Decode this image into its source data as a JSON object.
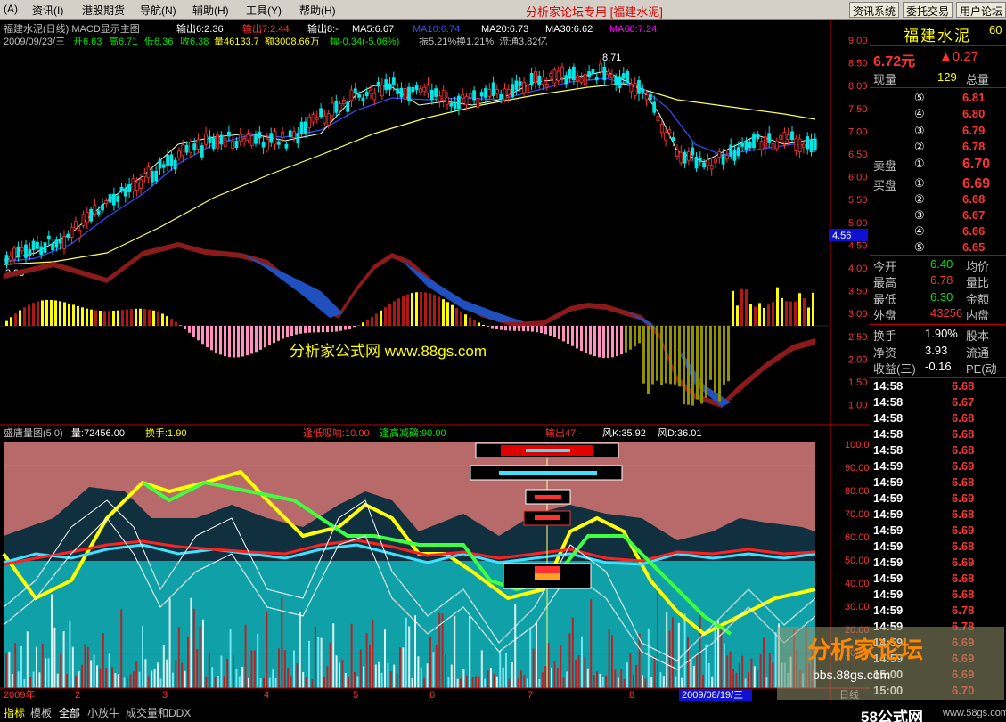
{
  "menu": {
    "items": [
      "(A)",
      "资讯(I)",
      "港股期货",
      "导航(N)",
      "辅助(H)",
      "工具(Y)",
      "帮助(H)"
    ],
    "center_title": "分析家论坛专用 [福建水泥]",
    "sys_buttons": [
      "资讯系统",
      "委托交易",
      "用户论坛"
    ]
  },
  "main_panel": {
    "header1": "福建水泥(日线) MACD显示主图",
    "output1": "输出6:2.36",
    "output2": "输出7:2.44",
    "output3": "输出8:-",
    "ma5": "MA5:6.67",
    "ma10": "MA10:6.74",
    "ma20": "MA20:6.73",
    "ma30": "MA30:6.62",
    "ma60": "MA60:7.24",
    "header2_date": "2009/09/23/三",
    "header2_open": "开6.63",
    "header2_high": "高6.71",
    "header2_low": "低6.36",
    "header2_close": "收6.38",
    "header2_vol": "量46133.7",
    "header2_amt": "额3008.66万",
    "header2_chg": "幅-0.34(-5.06%)",
    "header2_amp": "振5.21%",
    "header2_turn": "换1.21%",
    "header2_float": "流通3.82亿",
    "peak_label": "8.71",
    "low_label": "3.96",
    "watermark": "分析家公式网 www.88gs.com",
    "price_axis": [
      "9.00",
      "8.50",
      "8.00",
      "7.50",
      "7.00",
      "6.50",
      "6.00",
      "5.50",
      "5.00",
      "4.50",
      "4.00",
      "3.50",
      "3.00",
      "2.50",
      "2.00",
      "1.50",
      "1.00"
    ],
    "axis_marker": "4.56"
  },
  "sub_panel": {
    "header": "盛唐量图(5,0)",
    "vol": "量:72456.00",
    "turn": "换手:1.90",
    "low_absorb": "逢低吸呐:10.00",
    "high_reduce": "逢高减磅:90.00",
    "output47": "输出47:-",
    "windk": "风K:35.92",
    "windd": "风D:36.01",
    "axis": [
      "100.0",
      "90.00",
      "80.00",
      "70.00",
      "60.00",
      "50.00",
      "40.00",
      "30.00",
      "20.00",
      "10.00"
    ]
  },
  "time_axis": {
    "labels": [
      "2009年",
      "2",
      "3",
      "4",
      "5",
      "6",
      "7",
      "8"
    ],
    "cursor_date": "2009/08/19/三",
    "period": "日线"
  },
  "quote": {
    "name": "福建水泥",
    "code": "60",
    "price": "6.72元",
    "change": "▲0.27",
    "cur_vol_label": "现量",
    "cur_vol": "129",
    "total_vol_label": "总量",
    "sell_label": "卖盘",
    "buy_label": "买盘",
    "sell": [
      {
        "idx": "⑤",
        "price": "6.81"
      },
      {
        "idx": "④",
        "price": "6.80"
      },
      {
        "idx": "③",
        "price": "6.79"
      },
      {
        "idx": "②",
        "price": "6.78"
      },
      {
        "idx": "①",
        "price": "6.70"
      }
    ],
    "buy": [
      {
        "idx": "①",
        "price": "6.69"
      },
      {
        "idx": "②",
        "price": "6.68"
      },
      {
        "idx": "③",
        "price": "6.67"
      },
      {
        "idx": "④",
        "price": "6.66"
      },
      {
        "idx": "⑤",
        "price": "6.65"
      }
    ],
    "stats": [
      {
        "l": "今开",
        "v": "6.40",
        "r": "均价"
      },
      {
        "l": "最高",
        "v": "6.78",
        "r": "量比"
      },
      {
        "l": "最低",
        "v": "6.30",
        "r": "金额"
      },
      {
        "l": "外盘",
        "v": "43256",
        "r": "内盘"
      }
    ],
    "stats2": [
      {
        "l": "换手",
        "v": "1.90%",
        "r": "股本"
      },
      {
        "l": "净资",
        "v": "3.93",
        "r": "流通"
      },
      {
        "l": "收益(三)",
        "v": "-0.16",
        "r": "PE(动"
      }
    ],
    "ticks": [
      {
        "t": "14:58",
        "p": "6.68"
      },
      {
        "t": "14:58",
        "p": "6.67"
      },
      {
        "t": "14:58",
        "p": "6.68"
      },
      {
        "t": "14:58",
        "p": "6.68"
      },
      {
        "t": "14:58",
        "p": "6.68"
      },
      {
        "t": "14:59",
        "p": "6.69"
      },
      {
        "t": "14:59",
        "p": "6.68"
      },
      {
        "t": "14:59",
        "p": "6.69"
      },
      {
        "t": "14:59",
        "p": "6.68"
      },
      {
        "t": "14:59",
        "p": "6.69"
      },
      {
        "t": "14:59",
        "p": "6.68"
      },
      {
        "t": "14:59",
        "p": "6.69"
      },
      {
        "t": "14:59",
        "p": "6.68"
      },
      {
        "t": "14:59",
        "p": "6.68"
      },
      {
        "t": "14:59",
        "p": "6.78"
      },
      {
        "t": "14:59",
        "p": "6.78"
      },
      {
        "t": "14:59",
        "p": "6.69"
      },
      {
        "t": "14:59",
        "p": "6.69"
      },
      {
        "t": "15:00",
        "p": "6.69"
      },
      {
        "t": "15:00",
        "p": "6.70"
      },
      {
        "t": "15:00",
        "p": "6.70"
      }
    ],
    "corner_watermark": "分析家论坛",
    "corner_url": "bbs.88gs.com",
    "logo": "58公式网",
    "logo_url": "www.58gs.com"
  },
  "bottom_tabs": [
    "指标",
    "模板",
    "全部",
    "小放牛",
    "成交量和DDX"
  ],
  "colors": {
    "up": "#ff3232",
    "down": "#00e600",
    "ma5": "#ffffff",
    "ma10": "#3a4bff",
    "ma20": "#ffff00",
    "ma30": "#e6e6e6",
    "ma60": "#ff00ff",
    "axis": "#c00000"
  }
}
